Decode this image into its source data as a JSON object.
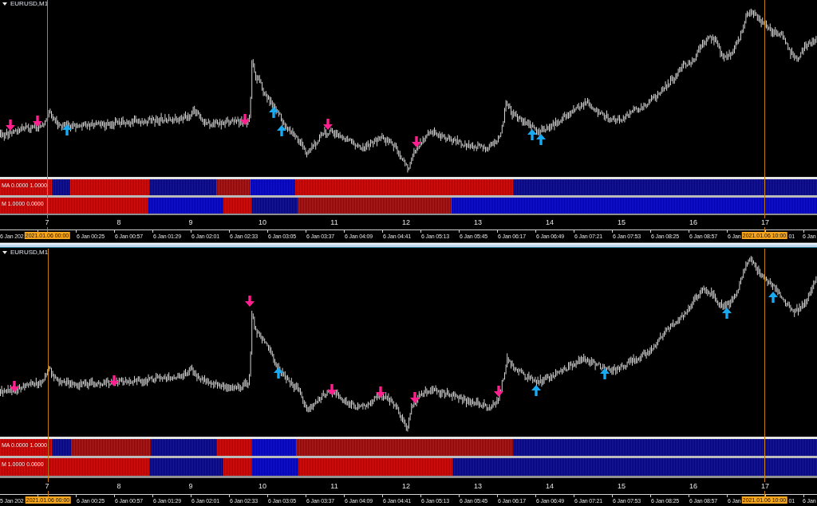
{
  "panels": [
    {
      "title": "EURUSD,M1",
      "indicators": [
        {
          "label": "MA 0.0000 1.0000"
        },
        {
          "label": "M 1.0000 0.0000"
        }
      ],
      "scale_labels": [
        "7",
        "8",
        "9",
        "10",
        "11",
        "12",
        "13",
        "14",
        "15",
        "16",
        "17"
      ],
      "time_labels": [
        {
          "kind": "label",
          "text": "6 Jan 202"
        },
        {
          "kind": "label",
          "text": "6 Jan 00:25"
        },
        {
          "kind": "label",
          "text": "6 Jan 00:57"
        },
        {
          "kind": "label",
          "text": "6 Jan 01:29"
        },
        {
          "kind": "label",
          "text": "6 Jan 02:01"
        },
        {
          "kind": "label",
          "text": "6 Jan 02:33"
        },
        {
          "kind": "label",
          "text": "6 Jan 03:05"
        },
        {
          "kind": "label",
          "text": "6 Jan 03:37"
        },
        {
          "kind": "label",
          "text": "6 Jan 04:09"
        },
        {
          "kind": "label",
          "text": "6 Jan 04:41"
        },
        {
          "kind": "label",
          "text": "6 Jan 05:13"
        },
        {
          "kind": "label",
          "text": "6 Jan 05:45"
        },
        {
          "kind": "label",
          "text": "6 Jan 06:17"
        },
        {
          "kind": "label",
          "text": "6 Jan 06:49"
        },
        {
          "kind": "label",
          "text": "6 Jan 07:21"
        },
        {
          "kind": "label",
          "text": "6 Jan 07:53"
        },
        {
          "kind": "label",
          "text": "6 Jan 08:25"
        },
        {
          "kind": "label",
          "text": "6 Jan 08:57"
        },
        {
          "kind": "label",
          "text": "6 Jan"
        },
        {
          "kind": "tail",
          "text": "01"
        },
        {
          "kind": "label",
          "text": "6 Jan"
        }
      ],
      "markers": [
        {
          "label": "2021.01.06 00:00"
        },
        {
          "label": "2021.01.06 10:00"
        }
      ]
    },
    {
      "title": "EURUSD,M1",
      "indicators": [
        {
          "label": "MA 0.0000 1.0000"
        },
        {
          "label": "M 1.0000 0.0000"
        }
      ],
      "scale_labels": [
        "7",
        "8",
        "9",
        "10",
        "11",
        "12",
        "13",
        "14",
        "15",
        "16",
        "17"
      ],
      "time_labels": [
        {
          "kind": "label",
          "text": "5 Jan 202"
        },
        {
          "kind": "label",
          "text": "6 Jan 00:25"
        },
        {
          "kind": "label",
          "text": "6 Jan 00:57"
        },
        {
          "kind": "label",
          "text": "6 Jan 01:29"
        },
        {
          "kind": "label",
          "text": "6 Jan 02:01"
        },
        {
          "kind": "label",
          "text": "6 Jan 02:33"
        },
        {
          "kind": "label",
          "text": "6 Jan 03:05"
        },
        {
          "kind": "label",
          "text": "6 Jan 03:37"
        },
        {
          "kind": "label",
          "text": "6 Jan 04:09"
        },
        {
          "kind": "label",
          "text": "6 Jan 04:41"
        },
        {
          "kind": "label",
          "text": "6 Jan 05:13"
        },
        {
          "kind": "label",
          "text": "6 Jan 05:45"
        },
        {
          "kind": "label",
          "text": "6 Jan 06:17"
        },
        {
          "kind": "label",
          "text": "6 Jan 06:49"
        },
        {
          "kind": "label",
          "text": "6 Jan 07:21"
        },
        {
          "kind": "label",
          "text": "6 Jan 07:53"
        },
        {
          "kind": "label",
          "text": "6 Jan 08:25"
        },
        {
          "kind": "label",
          "text": "6 Jan 08:57"
        },
        {
          "kind": "label",
          "text": "6 Jan"
        },
        {
          "kind": "tail",
          "text": "01"
        },
        {
          "kind": "label",
          "text": "6 Jan"
        }
      ],
      "markers": [
        {
          "label": "2021.01.06 00:00"
        },
        {
          "label": "2021.01.06 10:00"
        }
      ]
    }
  ]
}
